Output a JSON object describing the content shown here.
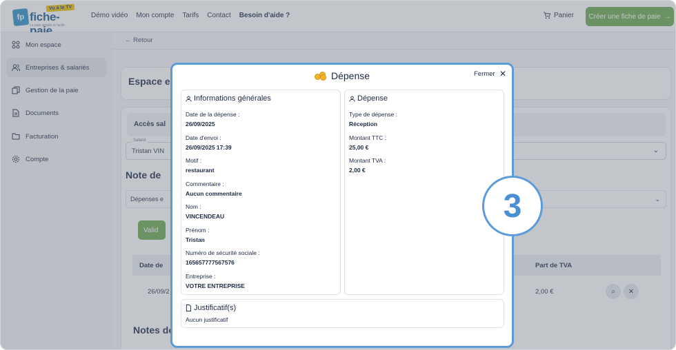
{
  "header": {
    "logo_name": "fiche-paie",
    "logo_tv": "Vu à la TV",
    "logo_tag": "La paie simple et facile",
    "nav": [
      "Démo vidéo",
      "Mon compte",
      "Tarifs",
      "Contact",
      "Besoin d'aide ?"
    ],
    "cart_label": "Panier",
    "cta_label": "Créer une fiche de paie"
  },
  "sidebar": {
    "items": [
      {
        "label": "Mon espace",
        "icon": "grid-icon"
      },
      {
        "label": "Entreprises & salariés",
        "icon": "users-icon"
      },
      {
        "label": "Gestion de la paie",
        "icon": "copy-icon"
      },
      {
        "label": "Documents",
        "icon": "document-icon"
      },
      {
        "label": "Facturation",
        "icon": "folder-icon"
      },
      {
        "label": "Compte",
        "icon": "gear-icon"
      }
    ]
  },
  "main": {
    "back_label": "Retour",
    "page_title": "Espace en",
    "acces_label": "Accès sal",
    "salarie_label": "Salarié",
    "salarie_value": "Tristan VIN",
    "note_title": "Note de",
    "depenses_label": "Dépenses e",
    "valid_label": "Valid",
    "table_headers": {
      "date": "Date de",
      "tva": "Part de TVA"
    },
    "row": {
      "date": "26/09/2",
      "tva": "2,00 €"
    },
    "notes_title": "Notes de"
  },
  "modal": {
    "title": "Dépense",
    "close_label": "Fermer",
    "general": {
      "title": "Informations générales",
      "fields": [
        {
          "label": "Date de la dépense :",
          "value": "26/09/2025"
        },
        {
          "label": "Date d'envoi :",
          "value": "26/09/2025 17:39"
        },
        {
          "label": "Motif :",
          "value": "restaurant"
        },
        {
          "label": "Commentaire :",
          "value": "Aucun commentaire"
        },
        {
          "label": "Nom :",
          "value": "VINCENDEAU"
        },
        {
          "label": "Prénom :",
          "value": "Tristan"
        },
        {
          "label": "Numéro de sécurité sociale :",
          "value": "165657777567576"
        },
        {
          "label": "Entreprise :",
          "value": "VOTRE ENTREPRISE"
        }
      ]
    },
    "expense": {
      "title": "Dépense",
      "fields": [
        {
          "label": "Type de dépense :",
          "value": "Réception"
        },
        {
          "label": "Montant TTC :",
          "value": "25,00 €"
        },
        {
          "label": "Montant TVA :",
          "value": "2,00 €"
        }
      ]
    },
    "justif": {
      "title": "Justificatif(s)",
      "value": "Aucun justificatif"
    }
  },
  "step_badge": "3"
}
